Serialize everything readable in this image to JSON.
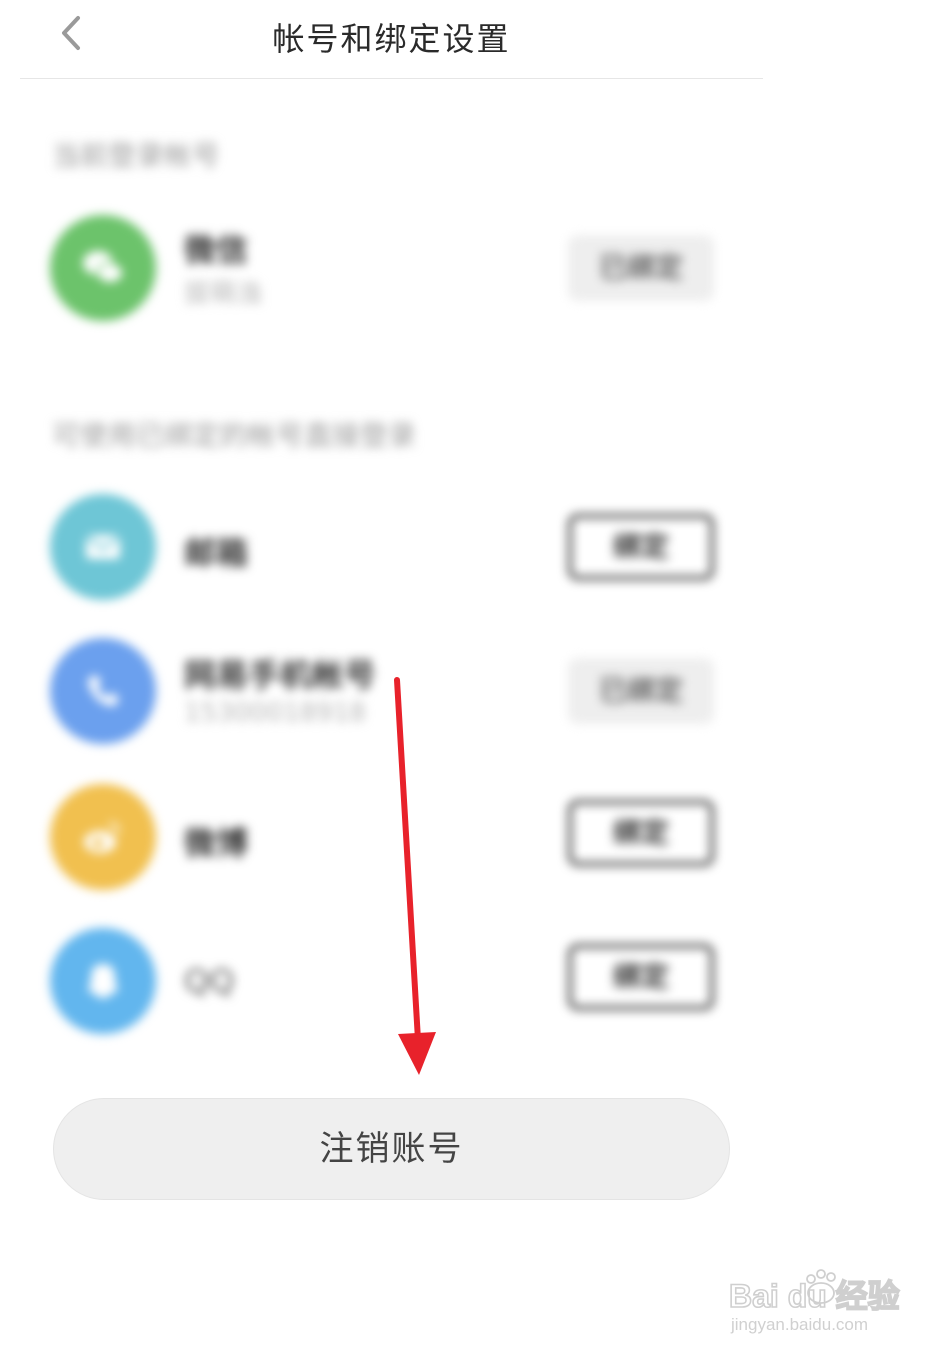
{
  "header": {
    "title": "帐号和绑定设置",
    "back_icon": "chevron-left-icon"
  },
  "sections": {
    "current_login_label": "当前登录帐号",
    "bindable_label": "可使用已绑定的帐号直接登录"
  },
  "accounts": [
    {
      "name": "微信",
      "sub": "拔萌浊",
      "button": "已绑定",
      "state": "bound",
      "icon": "wechat-icon",
      "color": "#6cc36b"
    },
    {
      "name": "邮箱",
      "sub": "",
      "button": "绑定",
      "state": "unbound",
      "icon": "mail-icon",
      "color": "#6ec6d6"
    },
    {
      "name": "网易手机帐号",
      "sub": "15300018918",
      "button": "已绑定",
      "state": "bound",
      "icon": "phone-icon",
      "color": "#6ba0ee"
    },
    {
      "name": "微博",
      "sub": "",
      "button": "绑定",
      "state": "unbound",
      "icon": "weibo-icon",
      "color": "#f1c04f"
    },
    {
      "name": "QQ",
      "sub": "",
      "button": "绑定",
      "state": "unbound",
      "icon": "qq-icon",
      "color": "#62b6ee"
    }
  ],
  "deactivate_button": "注销账号",
  "annotation": {
    "arrow_color": "#e8222b"
  },
  "watermark": {
    "logo_text": "Bai du 经验",
    "url": "jingyan.baidu.com"
  }
}
